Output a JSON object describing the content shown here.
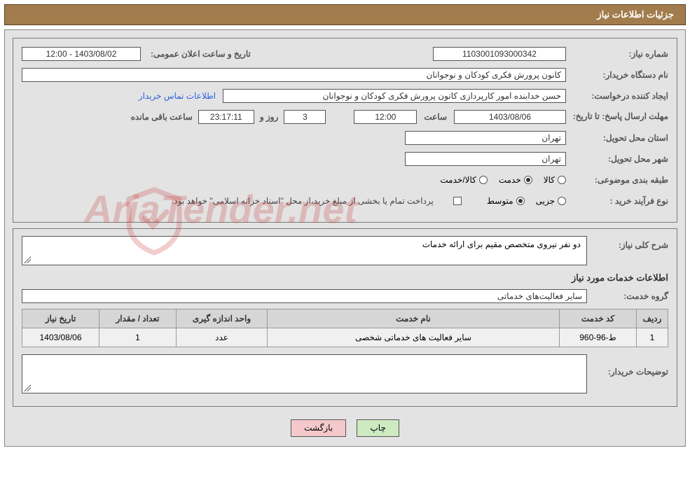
{
  "header": {
    "title": "جزئیات اطلاعات نیاز"
  },
  "fields": {
    "req_number_label": "شماره نیاز:",
    "req_number": "1103001093000342",
    "announce_label": "تاریخ و ساعت اعلان عمومی:",
    "announce_value": "1403/08/02 - 12:00",
    "buyer_org_label": "نام دستگاه خریدار:",
    "buyer_org": "کانون پرورش فکری کودکان و نوجوانان",
    "creator_label": "ایجاد کننده درخواست:",
    "creator": "حسن خدابنده امور کارپردازی  کانون پرورش فکری کودکان و نوجوانان",
    "contact_link": "اطلاعات تماس خریدار",
    "deadline_label": "مهلت ارسال پاسخ: تا تاریخ:",
    "deadline_date": "1403/08/06",
    "time_label": "ساعت",
    "deadline_time": "12:00",
    "days_value": "3",
    "days_and": "روز و",
    "countdown": "23:17:11",
    "remaining": "ساعت باقی مانده",
    "province_label": "استان محل تحویل:",
    "province": "تهران",
    "city_label": "شهر محل تحویل:",
    "city": "تهران",
    "category_label": "طبقه بندی موضوعی:",
    "radio_goods": "کالا",
    "radio_service": "خدمت",
    "radio_goods_service": "کالا/خدمت",
    "process_label": "نوع فرآیند خرید :",
    "radio_partial": "جزیی",
    "radio_medium": "متوسط",
    "payment_note": "پرداخت تمام یا بخشی از مبلغ خرید،از محل \"اسناد خزانه اسلامی\" خواهد بود.",
    "summary_label": "شرح کلی نیاز:",
    "summary_text": "دو نفر نیروی متخصص مقیم برای ارائه خدمات",
    "services_title": "اطلاعات خدمات مورد نیاز",
    "service_group_label": "گروه خدمت:",
    "service_group": "سایر فعالیت‌های خدماتی",
    "buyer_notes_label": "توضیحات خریدار:"
  },
  "table": {
    "headers": [
      "ردیف",
      "کد خدمت",
      "نام خدمت",
      "واحد اندازه گیری",
      "تعداد / مقدار",
      "تاریخ نیاز"
    ],
    "rows": [
      {
        "idx": "1",
        "code": "ط-96-960",
        "name": "سایر فعالیت های خدماتی شخصی",
        "unit": "عدد",
        "qty": "1",
        "date": "1403/08/06"
      }
    ]
  },
  "buttons": {
    "print": "چاپ",
    "back": "بازگشت"
  },
  "watermark": "AriaTender.net"
}
